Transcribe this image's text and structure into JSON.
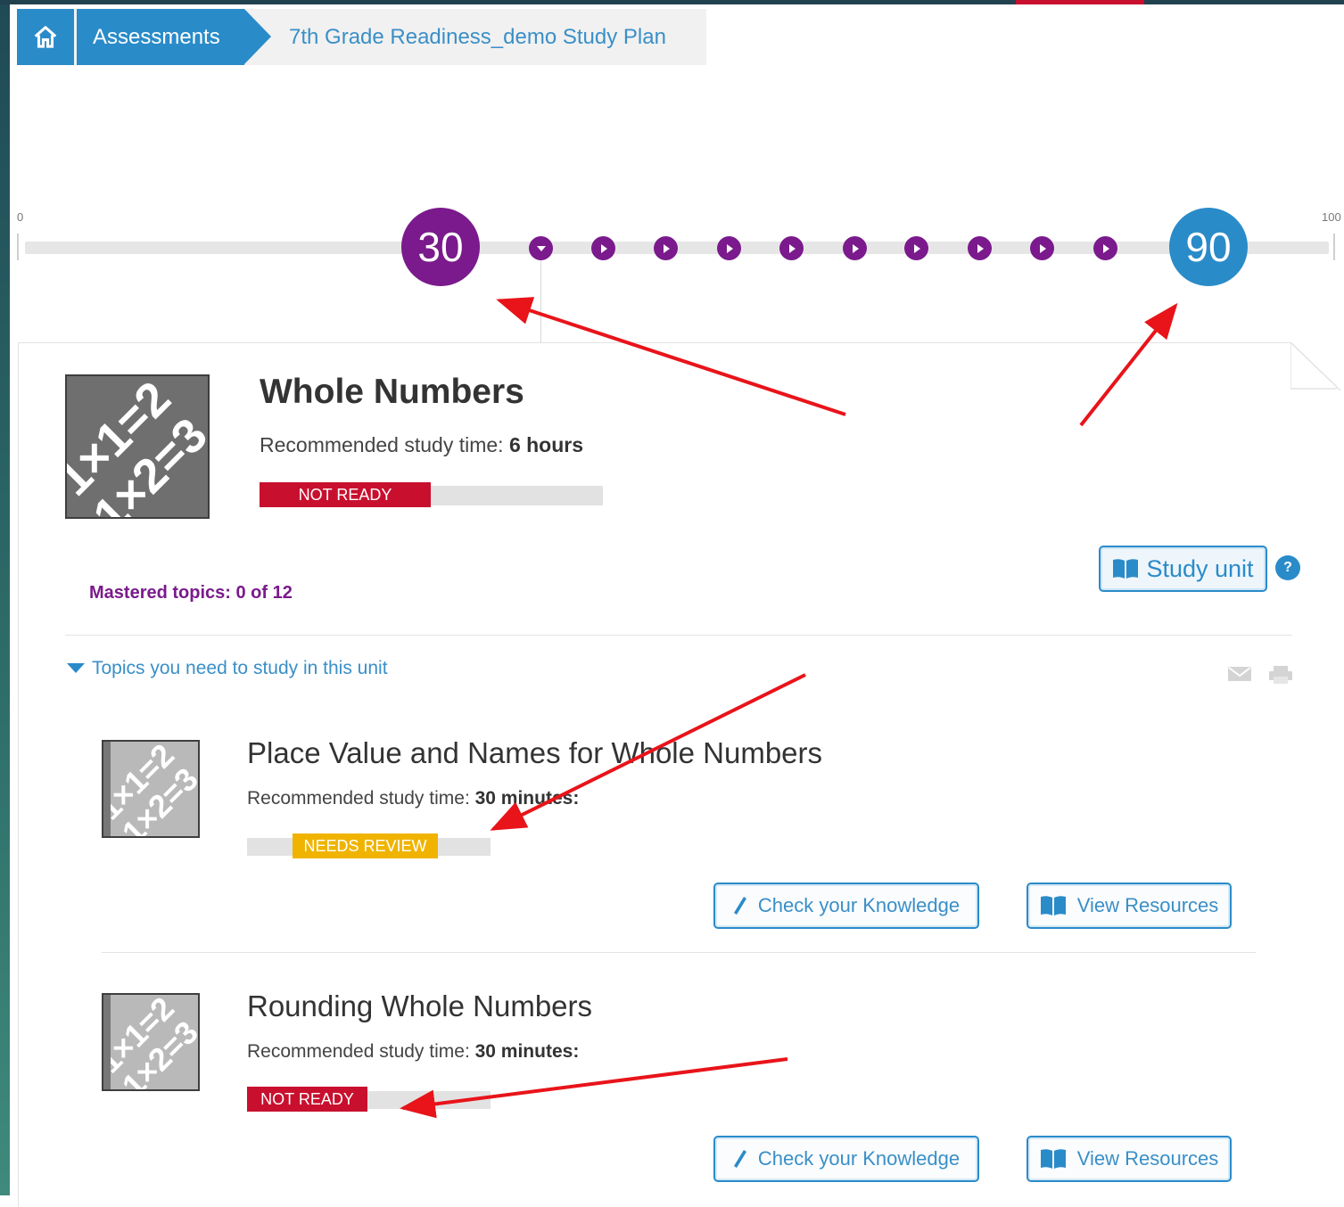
{
  "breadcrumb": {
    "home_icon": "home-icon",
    "assessments": "Assessments",
    "plan": "7th Grade Readiness_demo Study Plan"
  },
  "timeline": {
    "min_label": "0",
    "max_label": "100",
    "current_score": "30",
    "target_score": "90",
    "steps_between": 10
  },
  "unit": {
    "title": "Whole Numbers",
    "time_prefix": "Recommended study time: ",
    "time_value": "6 hours",
    "status": "NOT READY",
    "status_progress_pct": 50,
    "mastered": "Mastered topics: 0 of 12",
    "study_button": "Study unit",
    "help": "?"
  },
  "topics_toggle": "Topics you need to study in this unit",
  "topics": [
    {
      "title": "Place Value and Names for Whole Numbers",
      "time_prefix": "Recommended study time: ",
      "time_value": "30 minutes:",
      "status": "NEEDS REVIEW",
      "check_button": "Check your Knowledge",
      "resources_button": "View Resources"
    },
    {
      "title": "Rounding Whole Numbers",
      "time_prefix": "Recommended study time: ",
      "time_value": "30 minutes:",
      "status": "NOT READY",
      "check_button": "Check your Knowledge",
      "resources_button": "View Resources"
    }
  ],
  "colors": {
    "accent_blue": "#2a8bc9",
    "purple": "#7a1a8c",
    "not_ready_red": "#c8102e",
    "needs_review_yellow": "#f0b400",
    "annotation_arrow": "#e8141a"
  }
}
